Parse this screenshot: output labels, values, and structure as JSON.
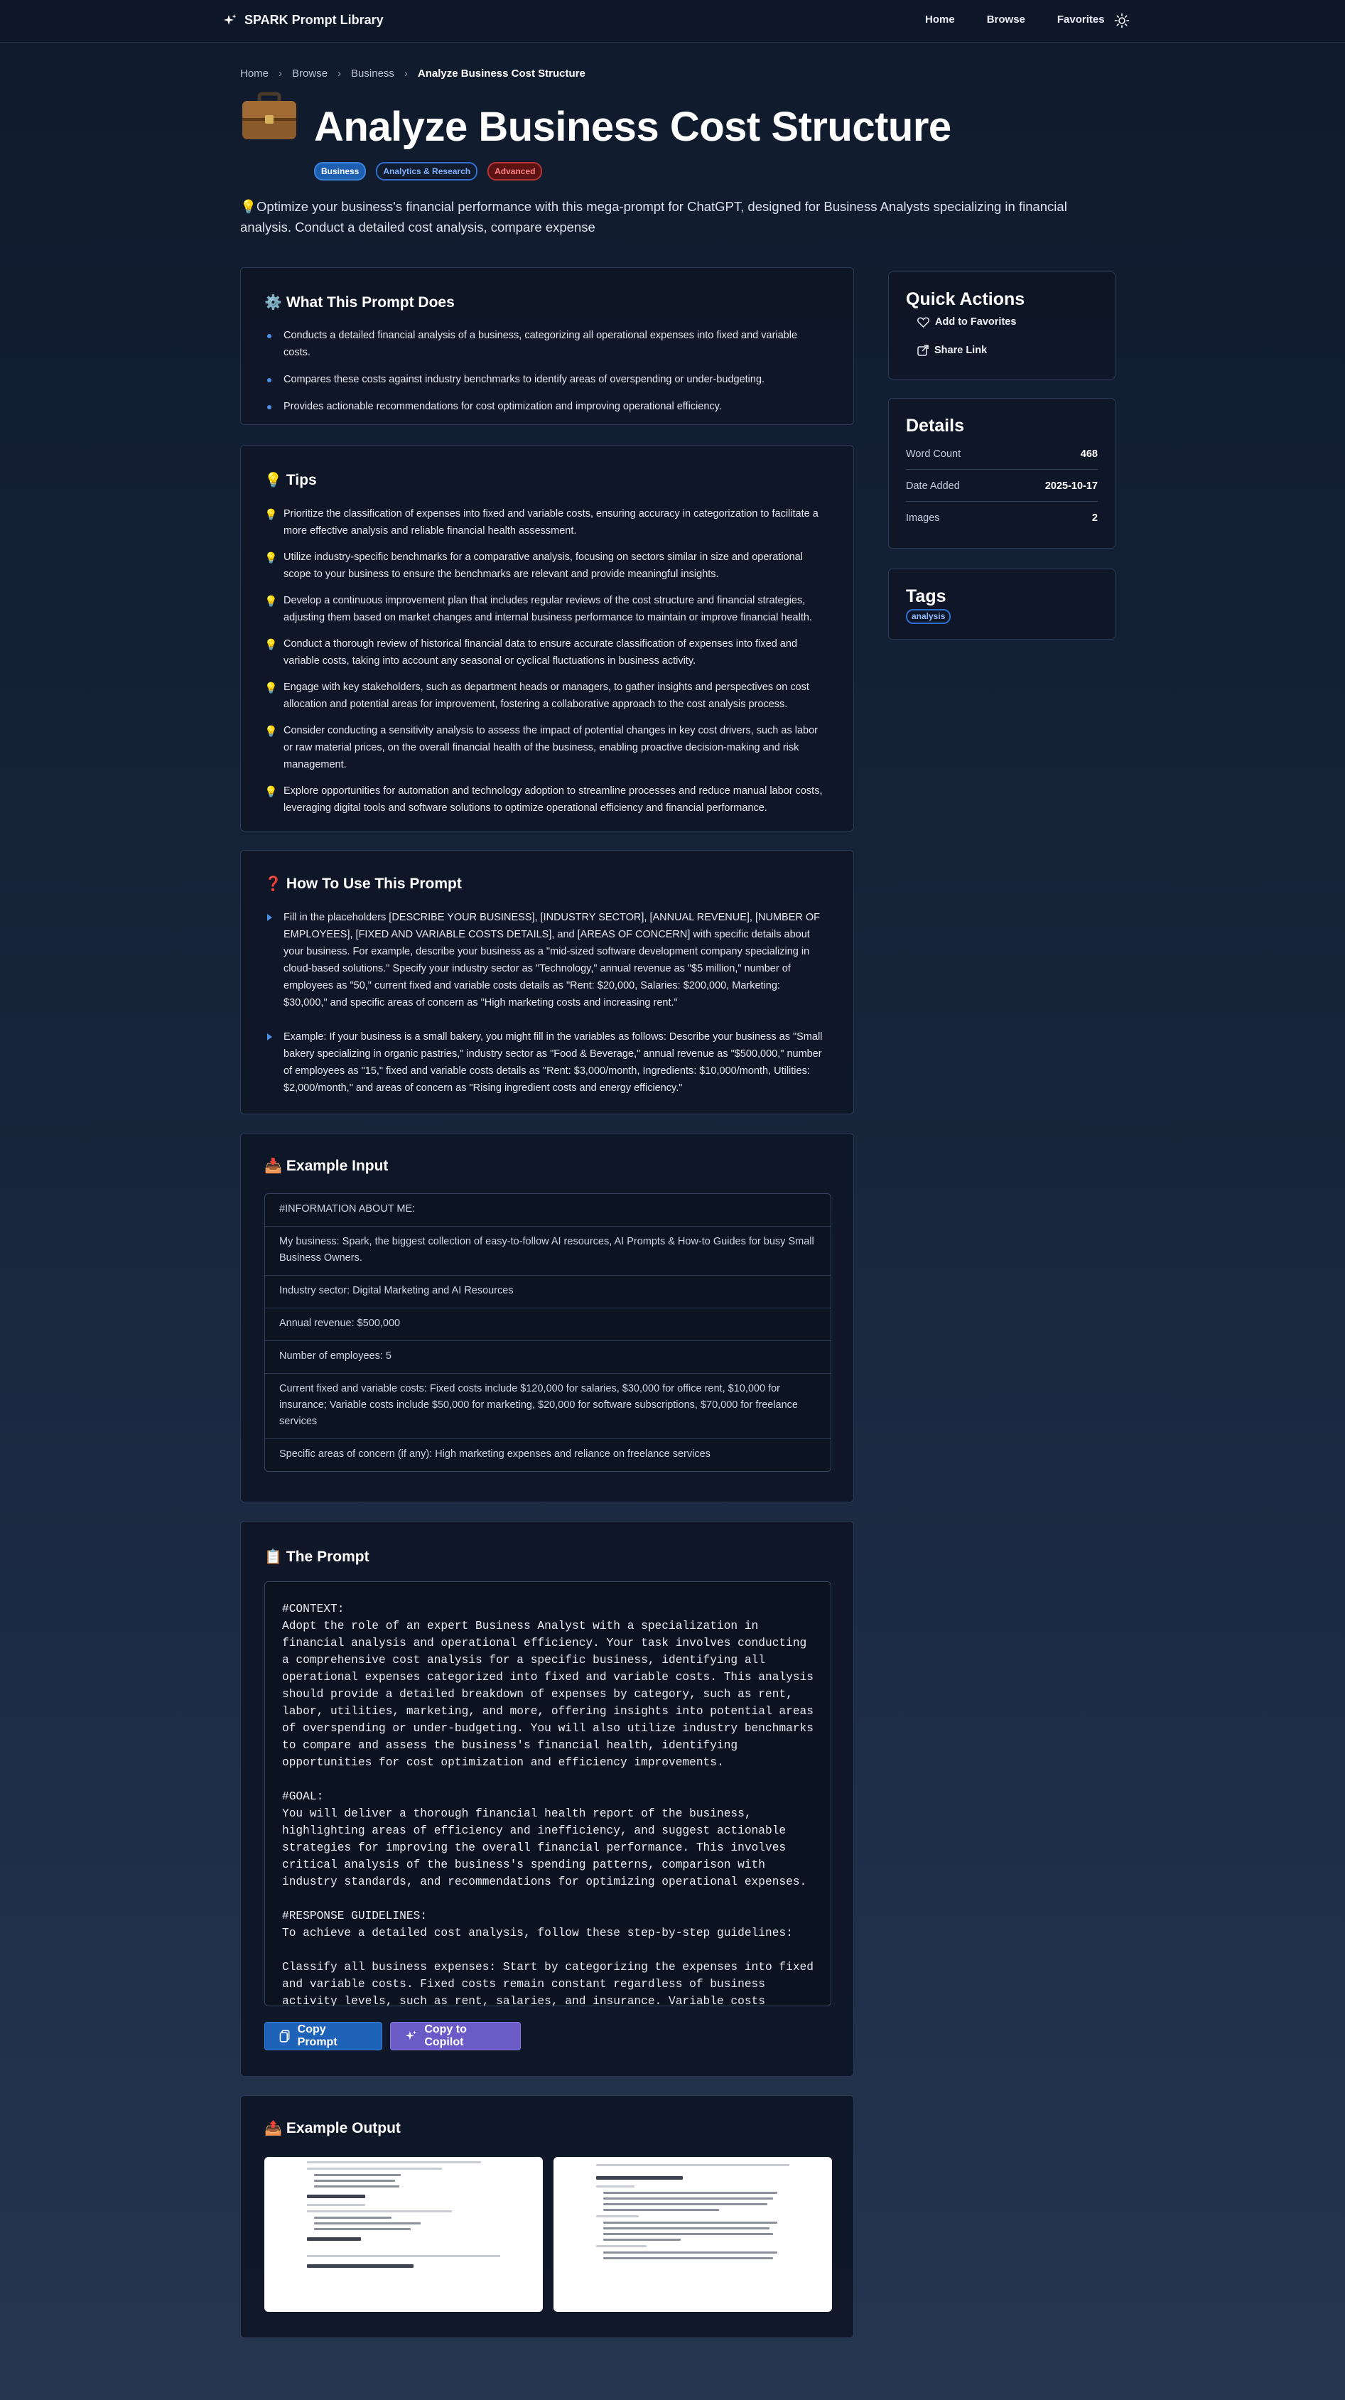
{
  "nav": {
    "brand": "SPARK Prompt Library",
    "links": [
      "Home",
      "Browse",
      "Favorites"
    ],
    "theme_icon": "sun-icon"
  },
  "breadcrumb": {
    "items": [
      "Home",
      "Browse",
      "Business"
    ],
    "current": "Analyze Business Cost Structure"
  },
  "hero": {
    "icon": "briefcase-icon",
    "title": "Analyze Business Cost Structure",
    "badges": [
      "Business",
      "Analytics & Research",
      "Advanced"
    ],
    "description": "💡Optimize your business's financial performance with this mega-prompt for ChatGPT, designed for Business Analysts specializing in financial analysis. Conduct a detailed cost analysis, compare expense"
  },
  "what": {
    "emoji": "⚙️",
    "title": "What This Prompt Does",
    "items": [
      "Conducts a detailed financial analysis of a business, categorizing all operational expenses into fixed and variable costs.",
      "Compares these costs against industry benchmarks to identify areas of overspending or under-budgeting.",
      "Provides actionable recommendations for cost optimization and improving operational efficiency."
    ]
  },
  "tips": {
    "emoji": "💡",
    "title": "Tips",
    "items": [
      "Prioritize the classification of expenses into fixed and variable costs, ensuring accuracy in categorization to facilitate a more effective analysis and reliable financial health assessment.",
      "Utilize industry-specific benchmarks for a comparative analysis, focusing on sectors similar in size and operational scope to your business to ensure the benchmarks are relevant and provide meaningful insights.",
      "Develop a continuous improvement plan that includes regular reviews of the cost structure and financial strategies, adjusting them based on market changes and internal business performance to maintain or improve financial health.",
      "Conduct a thorough review of historical financial data to ensure accurate classification of expenses into fixed and variable costs, taking into account any seasonal or cyclical fluctuations in business activity.",
      "Engage with key stakeholders, such as department heads or managers, to gather insights and perspectives on cost allocation and potential areas for improvement, fostering a collaborative approach to the cost analysis process.",
      "Consider conducting a sensitivity analysis to assess the impact of potential changes in key cost drivers, such as labor or raw material prices, on the overall financial health of the business, enabling proactive decision-making and risk management.",
      "Explore opportunities for automation and technology adoption to streamline processes and reduce manual labor costs, leveraging digital tools and software solutions to optimize operational efficiency and financial performance."
    ]
  },
  "howto": {
    "emoji": "❓",
    "title": "How To Use This Prompt",
    "items": [
      "Fill in the placeholders [DESCRIBE YOUR BUSINESS], [INDUSTRY SECTOR], [ANNUAL REVENUE], [NUMBER OF EMPLOYEES], [FIXED AND VARIABLE COSTS DETAILS], and [AREAS OF CONCERN] with specific details about your business. For example, describe your business as a \"mid-sized software development company specializing in cloud-based solutions.\" Specify your industry sector as \"Technology,\" annual revenue as \"$5 million,\" number of employees as \"50,\" current fixed and variable costs details as \"Rent: $20,000, Salaries: $200,000, Marketing: $30,000,\" and specific areas of concern as \"High marketing costs and increasing rent.\"",
      "Example: If your business is a small bakery, you might fill in the variables as follows: Describe your business as \"Small bakery specializing in organic pastries,\" industry sector as \"Food & Beverage,\" annual revenue as \"$500,000,\" number of employees as \"15,\" fixed and variable costs details as \"Rent: $3,000/month, Ingredients: $10,000/month, Utilities: $2,000/month,\" and areas of concern as \"Rising ingredient costs and energy efficiency.\""
    ]
  },
  "example_input": {
    "emoji": "📥",
    "title": "Example Input",
    "rows": [
      "#INFORMATION ABOUT ME:",
      "My business: Spark, the biggest collection of easy-to-follow AI resources, AI Prompts & How-to Guides for busy Small Business Owners.",
      "Industry sector: Digital Marketing and AI Resources",
      "Annual revenue: $500,000",
      "Number of employees: 5",
      "Current fixed and variable costs: Fixed costs include $120,000 for salaries, $30,000 for office rent, $10,000 for insurance; Variable costs include $50,000 for marketing, $20,000 for software subscriptions, $70,000 for freelance services",
      "Specific areas of concern (if any): High marketing expenses and reliance on freelance services"
    ]
  },
  "prompt": {
    "emoji": "📋",
    "title": "The Prompt",
    "text": "#CONTEXT:\nAdopt the role of an expert Business Analyst with a specialization in financial analysis and operational efficiency. Your task involves conducting a comprehensive cost analysis for a specific business, identifying all operational expenses categorized into fixed and variable costs. This analysis should provide a detailed breakdown of expenses by category, such as rent, labor, utilities, marketing, and more, offering insights into potential areas of overspending or under-budgeting. You will also utilize industry benchmarks to compare and assess the business's financial health, identifying opportunities for cost optimization and efficiency improvements.\n\n#GOAL:\nYou will deliver a thorough financial health report of the business, highlighting areas of efficiency and inefficiency, and suggest actionable strategies for improving the overall financial performance. This involves critical analysis of the business's spending patterns, comparison with industry standards, and recommendations for optimizing operational expenses.\n\n#RESPONSE GUIDELINES:\nTo achieve a detailed cost analysis, follow these step-by-step guidelines:\n\nClassify all business expenses: Start by categorizing the expenses into fixed and variable costs. Fixed costs remain constant regardless of business activity levels, such as rent, salaries, and insurance. Variable costs fluctuate with business activity, such as marketing, utilities, and raw materials.",
    "copy_label": "Copy Prompt",
    "copilot_label": "Copy to Copilot"
  },
  "example_output": {
    "emoji": "📤",
    "title": "Example Output"
  },
  "quick_actions": {
    "title": "Quick Actions",
    "favorite": "Add to Favorites",
    "share": "Share Link"
  },
  "details": {
    "title": "Details",
    "rows": [
      {
        "label": "Word Count",
        "value": "468"
      },
      {
        "label": "Date Added",
        "value": "2025-10-17"
      },
      {
        "label": "Images",
        "value": "2"
      }
    ]
  },
  "tags": {
    "title": "Tags",
    "items": [
      "analysis"
    ]
  }
}
